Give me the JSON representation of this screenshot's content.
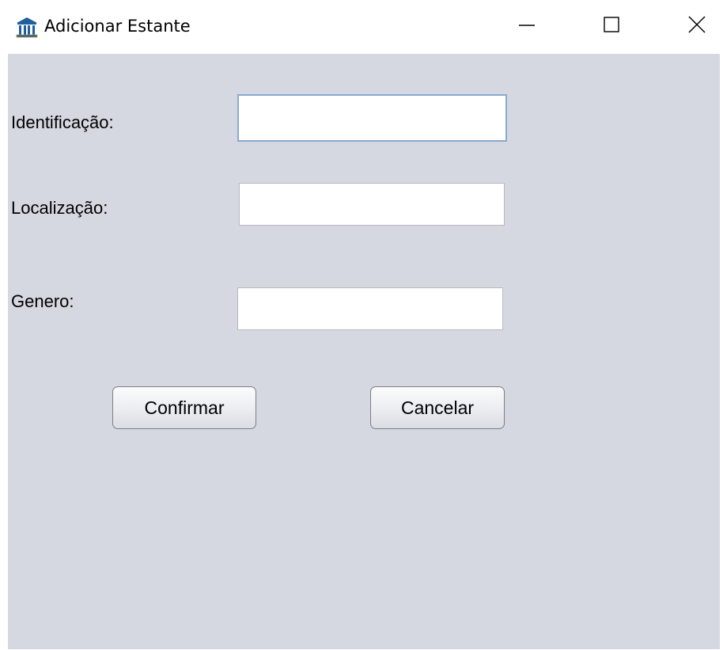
{
  "window": {
    "title": "Adicionar Estante",
    "icon": "museum-building-icon",
    "controls": [
      "minimize",
      "maximize",
      "close"
    ]
  },
  "form": {
    "fields": [
      {
        "label": "Identificação:",
        "value": "",
        "focused": true
      },
      {
        "label": "Localização:",
        "value": "",
        "focused": false
      },
      {
        "label": "Genero:",
        "value": "",
        "focused": false
      }
    ],
    "confirm_label": "Confirmar",
    "cancel_label": "Cancelar"
  },
  "colors": {
    "panel_background": "#d5d8e0",
    "focus_border": "#8aaad0",
    "icon_blue": "#1f5f9e"
  }
}
